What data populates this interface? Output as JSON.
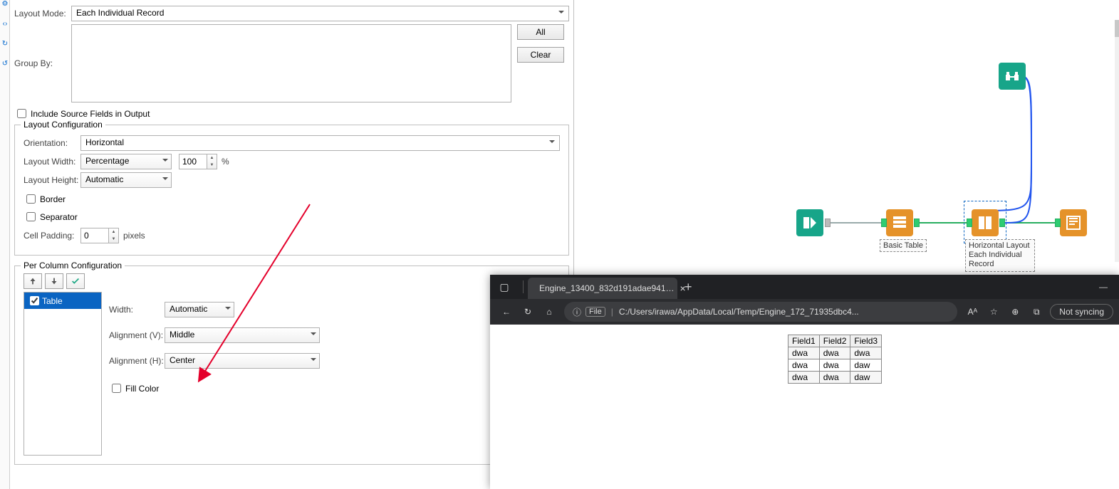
{
  "left_rail": {
    "icon1": "⚙",
    "icon2": "‹›",
    "icon3": "↻",
    "icon4": "↺"
  },
  "layout": {
    "mode_label": "Layout Mode:",
    "mode_value": "Each Individual Record",
    "groupby_label": "Group By:",
    "btn_all": "All",
    "btn_clear": "Clear",
    "include_src": "Include Source Fields in Output"
  },
  "config": {
    "legend": "Layout Configuration",
    "orientation_label": "Orientation:",
    "orientation_value": "Horizontal",
    "width_label": "Layout Width:",
    "width_mode": "Percentage",
    "width_value": "100",
    "width_unit": "%",
    "height_label": "Layout Height:",
    "height_mode": "Automatic",
    "border_label": "Border",
    "separator_label": "Separator",
    "padding_label": "Cell Padding:",
    "padding_value": "0",
    "padding_unit": "pixels"
  },
  "percol": {
    "legend": "Per Column Configuration",
    "list_item": "Table",
    "width_label": "Width:",
    "width_value": "Automatic",
    "av_label": "Alignment (V):",
    "av_value": "Middle",
    "ah_label": "Alignment (H):",
    "ah_value": "Center",
    "fill_label": "Fill Color"
  },
  "canvas": {
    "basic_table": "Basic Table",
    "hl_line1": "Horizontal Layout",
    "hl_line2": "Each Individual",
    "hl_line3": "Record"
  },
  "browser": {
    "tab_title": "Engine_13400_832d191adae941…",
    "file_chip": "File",
    "url": "C:/Users/irawa/AppData/Local/Temp/Engine_172_71935dbc4...",
    "sync": "Not syncing",
    "info_char": "ⓘ",
    "read_char": "Aᴬ",
    "star": "☆",
    "fav": "⊕",
    "collect": "⧉",
    "table": {
      "headers": [
        "Field1",
        "Field2",
        "Field3"
      ],
      "rows": [
        [
          "dwa",
          "dwa",
          "dwa"
        ],
        [
          "dwa",
          "dwa",
          "daw"
        ],
        [
          "dwa",
          "dwa",
          "daw"
        ]
      ]
    }
  }
}
